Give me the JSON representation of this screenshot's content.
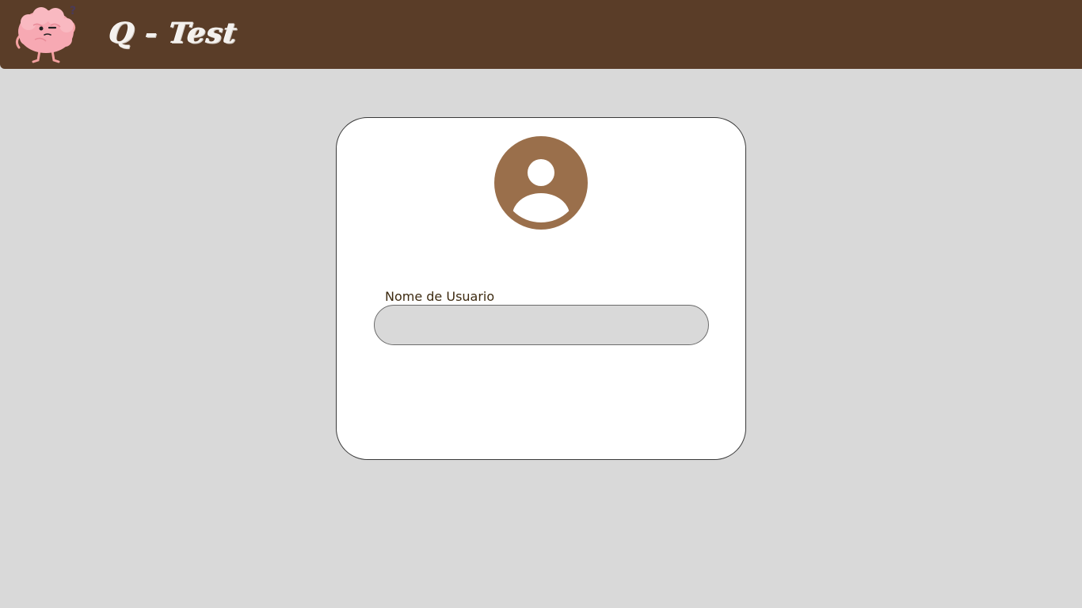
{
  "header": {
    "brand": "Q - Test",
    "logo_icon": "brain-mascot-icon",
    "background_color": "#5a3d28"
  },
  "login_card": {
    "avatar_icon": "user-avatar-icon",
    "avatar_color": "#9a6f4b",
    "username_label": "Nome de Usuario",
    "username_value": "",
    "username_placeholder": ""
  }
}
